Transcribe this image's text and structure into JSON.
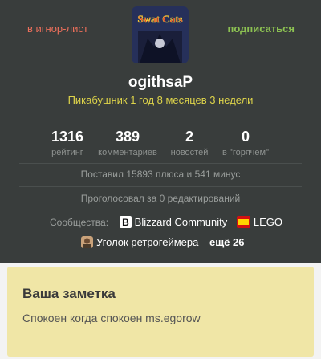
{
  "header": {
    "ignore_label": "в игнор-лист",
    "subscribe_label": "подписаться"
  },
  "profile": {
    "username": "ogithsaP",
    "since": "Пикабушник 1 год 8 месяцев 3 недели",
    "avatar_text": "Swat Cats"
  },
  "stats": [
    {
      "value": "1316",
      "label": "рейтинг"
    },
    {
      "value": "389",
      "label": "комментариев"
    },
    {
      "value": "2",
      "label": "новостей"
    },
    {
      "value": "0",
      "label": "в \"горячем\""
    }
  ],
  "votes_text": "Поставил 15893 плюса и 541 минус",
  "edits_text": "Проголосовал за 0 редактирований",
  "communities": {
    "label": "Сообщества:",
    "items": [
      "Blizzard Community",
      "LEGO",
      "Уголок ретрогеймера"
    ],
    "more": "ещё 26"
  },
  "note": {
    "title": "Ваша заметка",
    "text": "Спокоен когда спокоен ms.egorow"
  },
  "colors": {
    "bg": "#393d3c",
    "accent_red": "#ec6f5b",
    "accent_green": "#8cc152",
    "yellow": "#ddd34a",
    "note_bg": "#f0e6a6"
  }
}
